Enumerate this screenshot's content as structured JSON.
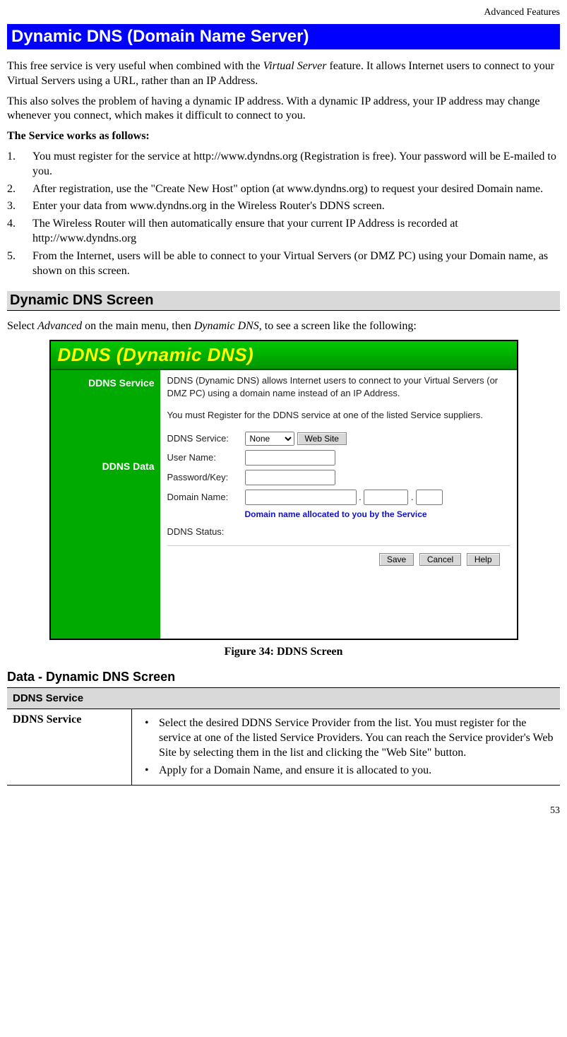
{
  "page_header": "Advanced Features",
  "page_number": "53",
  "h1": "Dynamic DNS (Domain Name Server)",
  "para1_pre": "This free service is very useful when combined with the ",
  "para1_em": "Virtual Server",
  "para1_post": " feature. It allows Internet users to connect to your Virtual Servers using a URL, rather than an IP Address.",
  "para2": "This also solves the problem of having a dynamic IP address. With a dynamic IP address, your IP address may change whenever you connect, which makes it difficult to connect to you.",
  "service_works_label": "The Service works as follows:",
  "steps": [
    "You must register for the service at http://www.dyndns.org (Registration is free). Your password will be E-mailed to you.",
    "After registration, use the \"Create New Host\" option (at www.dyndns.org) to request your desired Domain name.",
    "Enter your data from www.dyndns.org in the Wireless Router's DDNS screen.",
    "The Wireless Router will then automatically ensure that your current IP Address is recorded at http://www.dyndns.org",
    "From the Internet, users will be able to connect to your Virtual Servers (or DMZ PC) using your Domain name, as shown on this screen."
  ],
  "h2": "Dynamic DNS Screen",
  "select_instr_pre": "Select ",
  "select_instr_em1": "Advanced",
  "select_instr_mid": " on the main menu, then ",
  "select_instr_em2": "Dynamic DNS",
  "select_instr_post": ", to see a screen like the following:",
  "screenshot": {
    "title": "DDNS (Dynamic DNS)",
    "sidebar": {
      "service": "DDNS Service",
      "data": "DDNS Data"
    },
    "desc1": "DDNS (Dynamic DNS) allows Internet users to connect to your Virtual Servers (or DMZ PC) using a domain name instead of an IP Address.",
    "desc2": "You must Register for the DDNS service at one of the listed Service suppliers.",
    "labels": {
      "service": "DDNS Service:",
      "user": "User Name:",
      "pass": "Password/Key:",
      "domain": "Domain Name:",
      "status": "DDNS Status:"
    },
    "select_value": "None",
    "website_btn": "Web Site",
    "domain_note": "Domain name allocated to you by the Service",
    "save_btn": "Save",
    "cancel_btn": "Cancel",
    "help_btn": "Help"
  },
  "fig_caption": "Figure 34: DDNS Screen",
  "h3": "Data - Dynamic DNS Screen",
  "table": {
    "section": "DDNS Service",
    "row1_label": "DDNS Service",
    "row1_bullets": [
      "Select the desired DDNS Service Provider from the list. You must register for the service at one of the listed Service Providers. You can reach the Service provider's Web Site by selecting them in the list and clicking the \"Web Site\" button.",
      "Apply for a Domain Name, and ensure it is allocated to you."
    ]
  }
}
